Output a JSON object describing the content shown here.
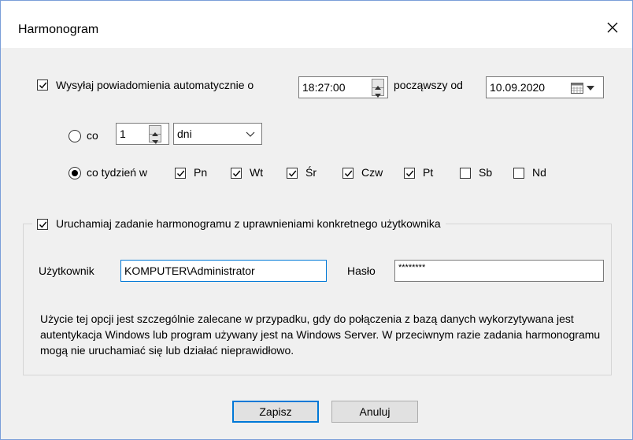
{
  "window": {
    "title": "Harmonogram",
    "close_glyph": "✕"
  },
  "auto_send": {
    "checked": true,
    "label": "Wysyłaj powiadomienia automatycznie o",
    "time": "18:27:00",
    "from_label": "począwszy od",
    "date": "10.09.2020"
  },
  "repeat_every": {
    "selected": false,
    "label": "co",
    "count": "1",
    "unit_selected": "dni"
  },
  "weekly": {
    "selected": true,
    "label": "co tydzień w",
    "days": [
      {
        "label": "Pn",
        "checked": true
      },
      {
        "label": "Wt",
        "checked": true
      },
      {
        "label": "Śr",
        "checked": true
      },
      {
        "label": "Czw",
        "checked": true
      },
      {
        "label": "Pt",
        "checked": true
      },
      {
        "label": "Sb",
        "checked": false
      },
      {
        "label": "Nd",
        "checked": false
      }
    ]
  },
  "run_as": {
    "checked": true,
    "label": "Uruchamiaj zadanie harmonogramu z uprawnieniami konkretnego użytkownika",
    "user_label": "Użytkownik",
    "user_value": "KOMPUTER\\Administrator",
    "password_label": "Hasło",
    "password_value": "********",
    "description": "Użycie tej opcji jest szczególnie zalecane w przypadku, gdy do połączenia z bazą danych wykorzytywana jest autentykacja Windows lub program używany jest na Windows Server. W przeciwnym razie zadania harmonogramu mogą nie uruchamiać się lub działać nieprawidłowo."
  },
  "buttons": {
    "save": "Zapisz",
    "cancel": "Anuluj"
  },
  "colors": {
    "accent": "#0078d7",
    "background": "#f0f0f0",
    "titlebar": "#ffffff"
  }
}
